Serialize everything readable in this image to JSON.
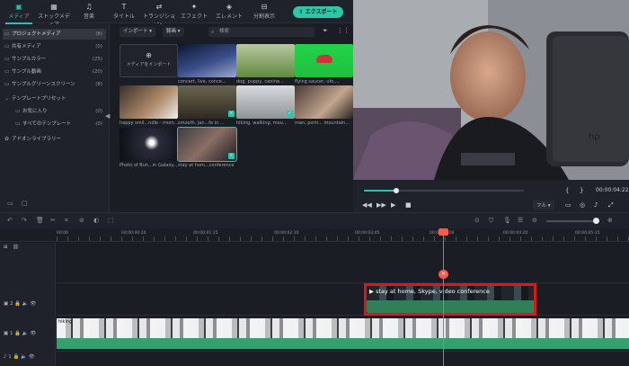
{
  "tabs": [
    {
      "label": "メディア",
      "icon": "media-icon"
    },
    {
      "label": "ストックメディア",
      "icon": "stock-media-icon"
    },
    {
      "label": "音楽",
      "icon": "music-icon"
    },
    {
      "label": "タイトル",
      "icon": "title-icon"
    },
    {
      "label": "トランジション",
      "icon": "transition-icon"
    },
    {
      "label": "エフェクト",
      "icon": "effect-icon"
    },
    {
      "label": "エレメント",
      "icon": "element-icon"
    },
    {
      "label": "分割表示",
      "icon": "split-screen-icon"
    }
  ],
  "export_label": "エクスポート",
  "tree": [
    {
      "label": "プロジェクトメディア",
      "count": "(8)",
      "selected": true
    },
    {
      "label": "共有メディア",
      "count": "(0)"
    },
    {
      "label": "サンプルカラー",
      "count": "(25)"
    },
    {
      "label": "サンプル動画",
      "count": "(20)"
    },
    {
      "label": "サンプルグリーンスクリーン",
      "count": "(8)"
    },
    {
      "label": "テンプレートプリセット",
      "count": ""
    },
    {
      "label": "お気に入り",
      "count": "(0)"
    },
    {
      "label": "すべてのテンプレート",
      "count": "(0)"
    },
    {
      "label": "アドオンライブラリー",
      "count": ""
    }
  ],
  "media_toolbar": {
    "import": "インポート",
    "record": "録画",
    "search_placeholder": "検索"
  },
  "import_tile_label": "メディアをインポート",
  "media_items": [
    {
      "caption": "concert, live, conce...",
      "checked": false
    },
    {
      "caption": "dog, puppy, canine...",
      "checked": false
    },
    {
      "caption": "flying saucer, ufo,...",
      "checked": false
    },
    {
      "caption": "happy smil...ndle - mom...",
      "checked": false
    },
    {
      "caption": "smooth, jan...fe in ...",
      "checked": true
    },
    {
      "caption": "hiking, walking, mou...",
      "checked": true
    },
    {
      "caption": "man, portr... mountain...",
      "checked": false
    },
    {
      "caption": "Photo of Bun...in Galaxy...",
      "checked": false
    },
    {
      "caption": "stay at hom...conference",
      "checked": true
    }
  ],
  "player": {
    "timecode": "00:00:04:22",
    "quality": "フル",
    "progress": 0.2
  },
  "ruler_labels": [
    "00:00",
    "00:00:00:20",
    "00:00:01:15",
    "00:00:02:10",
    "00:00:03:05",
    "00:00:04:00",
    "00:00:04:20",
    "00:00:05:15",
    "00:00:06:10"
  ],
  "track_heads": [
    {
      "label": "2",
      "track": "video-2"
    },
    {
      "label": "1",
      "track": "video-1"
    },
    {
      "label": "1",
      "track": "audio-1"
    }
  ],
  "timeline_clips": {
    "upper": "stay at home, Skype, video conference",
    "lower": "hiking"
  },
  "colors": {
    "accent": "#27c6b0",
    "highlight": "#e0141e",
    "clip_green": "#34a06e",
    "playhead": "#ff5a4e"
  }
}
